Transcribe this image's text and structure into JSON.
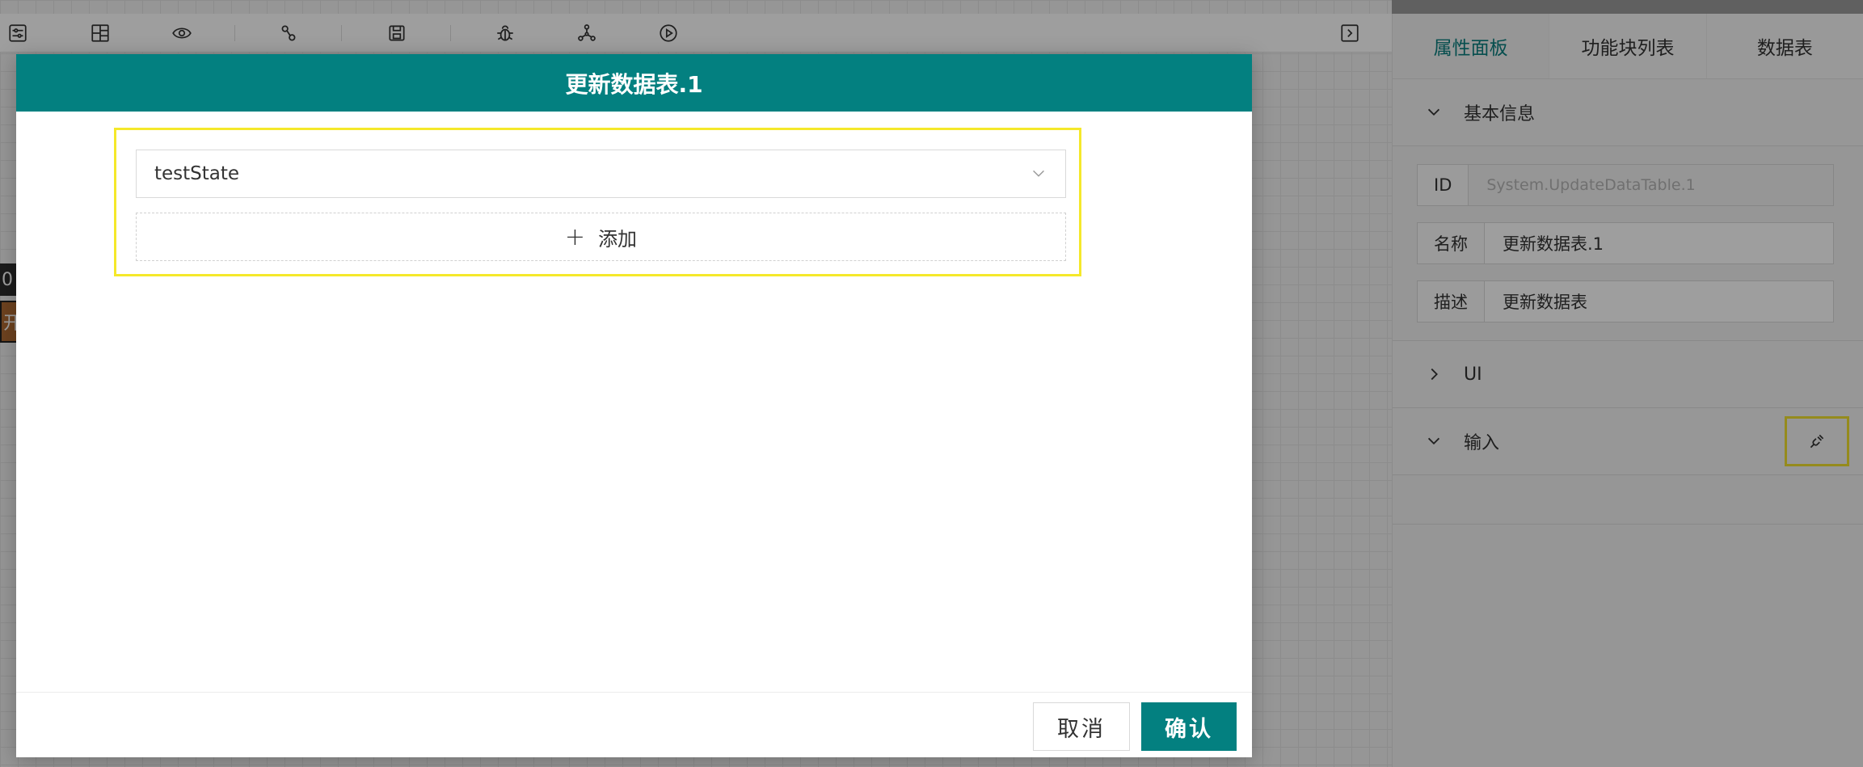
{
  "editor": {
    "node_stub_a": "0",
    "node_stub_b": "开"
  },
  "toolbar": {
    "icons": [
      "settings-sliders-icon",
      "layout-icon",
      "eye-icon",
      "link-icon",
      "save-icon",
      "debug-bug-icon",
      "network-graph-icon",
      "play-icon",
      "collapse-panel-icon"
    ]
  },
  "side_panel": {
    "tabs": [
      {
        "label": "属性面板",
        "active": true
      },
      {
        "label": "功能块列表",
        "active": false
      },
      {
        "label": "数据表",
        "active": false
      }
    ],
    "basic_info": {
      "title": "基本信息",
      "fields": [
        {
          "label": "ID",
          "value": "System.UpdateDataTable.1",
          "disabled": true
        },
        {
          "label": "名称",
          "value": "更新数据表.1"
        },
        {
          "label": "描述",
          "value": "更新数据表"
        }
      ]
    },
    "ui_section": {
      "title": "UI"
    },
    "input_section": {
      "title": "输入"
    }
  },
  "modal": {
    "title": "更新数据表.1",
    "select_value": "testState",
    "add_label": "添加",
    "cancel_label": "取消",
    "confirm_label": "确认"
  },
  "colors": {
    "accent": "#038080",
    "highlight": "#f5e82a"
  }
}
